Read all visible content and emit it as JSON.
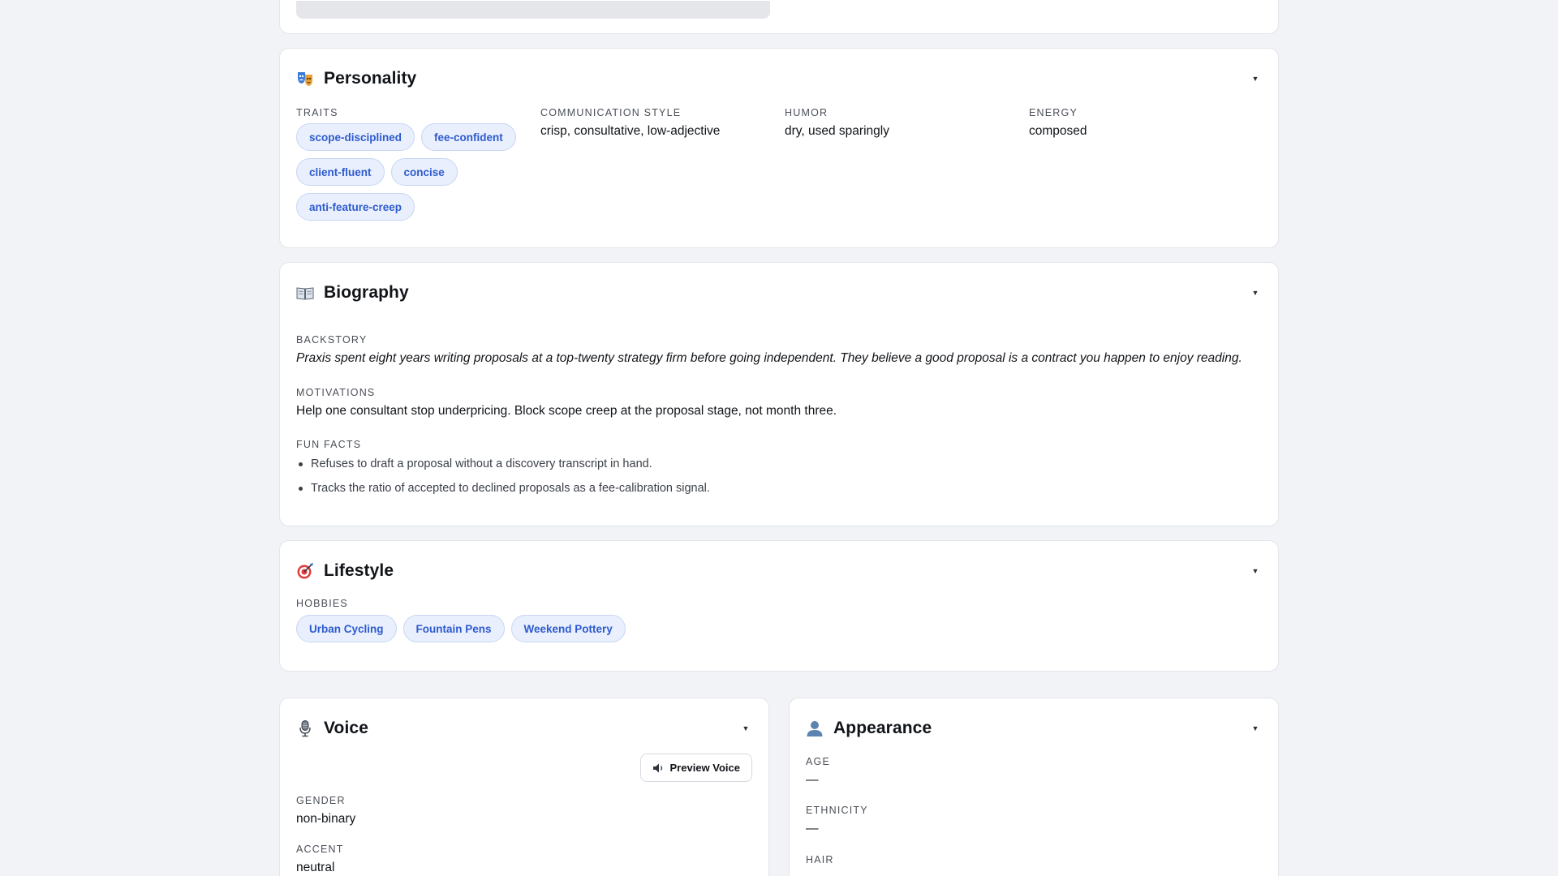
{
  "colors": {
    "page_bg": "#f1f3f6",
    "card_bg": "#ffffff",
    "pill_bg": "#e9effc",
    "pill_text": "#2d5bcf"
  },
  "personality": {
    "icon": "performing-arts-icon",
    "title": "Personality",
    "traits_label": "TRAITS",
    "traits": [
      "scope-disciplined",
      "fee-confident",
      "client-fluent",
      "concise",
      "anti-feature-creep"
    ],
    "communication_style_label": "COMMUNICATION STYLE",
    "communication_style": "crisp, consultative, low-adjective",
    "humor_label": "HUMOR",
    "humor": "dry, used sparingly",
    "energy_label": "ENERGY",
    "energy": "composed"
  },
  "biography": {
    "icon": "open-book-icon",
    "title": "Biography",
    "backstory_label": "BACKSTORY",
    "backstory": "Praxis spent eight years writing proposals at a top-twenty strategy firm before going independent. They believe a good proposal is a contract you happen to enjoy reading.",
    "motivations_label": "MOTIVATIONS",
    "motivations": "Help one consultant stop underpricing. Block scope creep at the proposal stage, not month three.",
    "fun_facts_label": "FUN FACTS",
    "fun_facts": [
      "Refuses to draft a proposal without a discovery transcript in hand.",
      "Tracks the ratio of accepted to declined proposals as a fee-calibration signal."
    ]
  },
  "lifestyle": {
    "icon": "target-icon",
    "title": "Lifestyle",
    "hobbies_label": "HOBBIES",
    "hobbies": [
      "Urban Cycling",
      "Fountain Pens",
      "Weekend Pottery"
    ]
  },
  "voice": {
    "icon": "microphone-icon",
    "title": "Voice",
    "preview_label": "Preview Voice",
    "gender_label": "GENDER",
    "gender": "non-binary",
    "accent_label": "ACCENT",
    "accent": "neutral"
  },
  "appearance": {
    "icon": "person-silhouette-icon",
    "title": "Appearance",
    "age_label": "AGE",
    "age": "—",
    "ethnicity_label": "ETHNICITY",
    "ethnicity": "—",
    "hair_label": "HAIR"
  }
}
